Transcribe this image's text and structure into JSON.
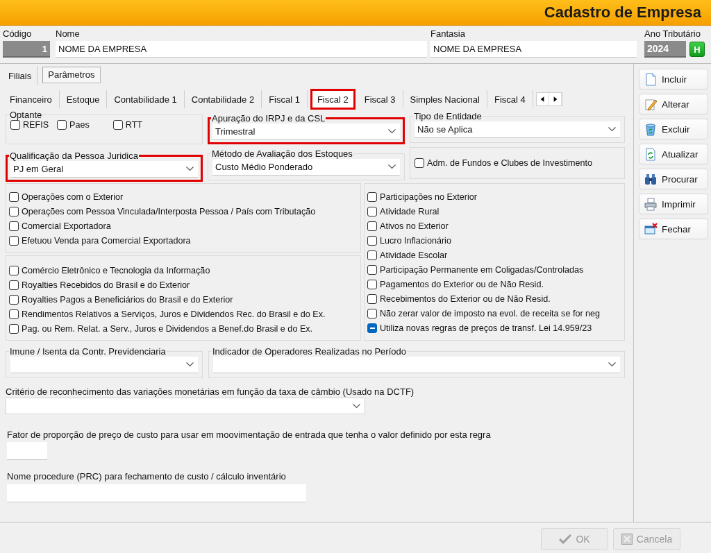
{
  "window": {
    "title": "Cadastro de Empresa"
  },
  "header": {
    "fields": [
      {
        "label": "Código",
        "value": "1",
        "kind": "code"
      },
      {
        "label": "Nome",
        "value": "NOME DA EMPRESA",
        "kind": "text"
      },
      {
        "label": "Fantasia",
        "value": "NOME DA EMPRESA",
        "kind": "text"
      },
      {
        "label": "Ano Tributário",
        "value": "2024",
        "kind": "year"
      }
    ],
    "help_button": "H"
  },
  "outer_tabs": [
    {
      "label": "Filiais",
      "selected": false
    },
    {
      "label": "Parâmetros",
      "selected": true
    }
  ],
  "inner_tabs": [
    {
      "label": "Financeiro",
      "selected": false,
      "highlighted": false
    },
    {
      "label": "Estoque",
      "selected": false,
      "highlighted": false
    },
    {
      "label": "Contabilidade 1",
      "selected": false,
      "highlighted": false
    },
    {
      "label": "Contabilidade 2",
      "selected": false,
      "highlighted": false
    },
    {
      "label": "Fiscal 1",
      "selected": false,
      "highlighted": false
    },
    {
      "label": "Fiscal 2",
      "selected": true,
      "highlighted": true
    },
    {
      "label": "Fiscal 3",
      "selected": false,
      "highlighted": false
    },
    {
      "label": "Simples Nacional",
      "selected": false,
      "highlighted": false
    },
    {
      "label": "Fiscal 4",
      "selected": false,
      "highlighted": false
    }
  ],
  "optante": {
    "title": "Optante",
    "options": [
      {
        "label": "REFIS",
        "checked": false
      },
      {
        "label": "Paes",
        "checked": false
      },
      {
        "label": "RTT",
        "checked": false
      }
    ]
  },
  "qualificacao": {
    "title": "Qualificação da Pessoa Juridica",
    "value": "PJ em Geral",
    "highlighted": true
  },
  "apuracao": {
    "title": "Apuração do IRPJ e da CSL",
    "value": "Trimestral",
    "highlighted": true
  },
  "metodo": {
    "title": "Método de Avaliação dos Estoques",
    "value": "Custo Médio Ponderado",
    "highlighted": false
  },
  "tipo_entidade": {
    "title": "Tipo de Entidade",
    "value": "Não se Aplica",
    "highlighted": false
  },
  "adm_fundos": {
    "label": "Adm. de Fundos e Clubes de Investimento",
    "checked": false
  },
  "checkbox_panels": [
    {
      "items": [
        {
          "label": "Operações com o Exterior",
          "checked": false,
          "indeterminate": false
        },
        {
          "label": "Operações com Pessoa Vinculada/Interposta Pessoa / País com Tributação",
          "checked": false,
          "indeterminate": false
        },
        {
          "label": "Comercial Exportadora",
          "checked": false,
          "indeterminate": false
        },
        {
          "label": "Efetuou Venda para Comercial Exportadora",
          "checked": false,
          "indeterminate": false
        }
      ]
    },
    {
      "items": [
        {
          "label": "Comércio Eletrônico e Tecnologia da Informação",
          "checked": false,
          "indeterminate": false
        },
        {
          "label": "Royalties Recebidos do Brasil e do Exterior",
          "checked": false,
          "indeterminate": false
        },
        {
          "label": "Royalties Pagos a Beneficiários do Brasil e do Exterior",
          "checked": false,
          "indeterminate": false
        },
        {
          "label": "Rendimentos Relativos a Serviços, Juros e Dividendos Rec. do Brasil e do Ex.",
          "checked": false,
          "indeterminate": false
        },
        {
          "label": "Pag. ou Rem.  Relat. a Serv., Juros e Dividendos a Benef.do Brasil e do Ex.",
          "checked": false,
          "indeterminate": false
        }
      ]
    },
    {
      "items": [
        {
          "label": "Participações no Exterior",
          "checked": false,
          "indeterminate": false
        },
        {
          "label": "Atividade Rural",
          "checked": false,
          "indeterminate": false
        },
        {
          "label": "Ativos no Exterior",
          "checked": false,
          "indeterminate": false
        },
        {
          "label": "Lucro Inflacionário",
          "checked": false,
          "indeterminate": false
        },
        {
          "label": "Atividade Escolar",
          "checked": false,
          "indeterminate": false
        },
        {
          "label": "Participação Permanente em Coligadas/Controladas",
          "checked": false,
          "indeterminate": false
        },
        {
          "label": "Pagamentos do Exterior ou de Não Resid.",
          "checked": false,
          "indeterminate": false
        },
        {
          "label": "Recebimentos do Exterior ou de Não Resid.",
          "checked": false,
          "indeterminate": false
        },
        {
          "label": "Não zerar valor de imposto na evol. de receita se for neg",
          "checked": false,
          "indeterminate": false
        },
        {
          "label": "Utiliza novas regras de preços de transf.  Lei 14.959/23",
          "checked": true,
          "indeterminate": true
        }
      ]
    }
  ],
  "imune": {
    "title": "Imune / Isenta da Contr. Previdenciaria"
  },
  "indicador": {
    "title": "Indicador de Operadores Realizadas no Período"
  },
  "criterio": {
    "label": "Critério de reconhecimento das variações monetárias em função da taxa de câmbio  (Usado na DCTF)"
  },
  "fator": {
    "label": "Fator de proporção de preço de custo para usar em moovimentação de entrada que tenha o valor definido por esta regra"
  },
  "procedure": {
    "label": "Nome procedure (PRC) para fechamento de custo / cálculo inventário"
  },
  "actions": [
    {
      "label": "Incluir",
      "kind": "new"
    },
    {
      "label": "Alterar",
      "kind": "edit"
    },
    {
      "label": "Excluir",
      "kind": "delete"
    },
    {
      "label": "Atualizar",
      "kind": "refresh"
    },
    {
      "label": "Procurar",
      "kind": "search"
    },
    {
      "label": "Imprimir",
      "kind": "print"
    },
    {
      "label": "Fechar",
      "kind": "close"
    }
  ],
  "footer_buttons": [
    {
      "label": "OK",
      "kind": "ok",
      "disabled": true
    },
    {
      "label": "Cancela",
      "kind": "cancel",
      "disabled": true
    }
  ]
}
